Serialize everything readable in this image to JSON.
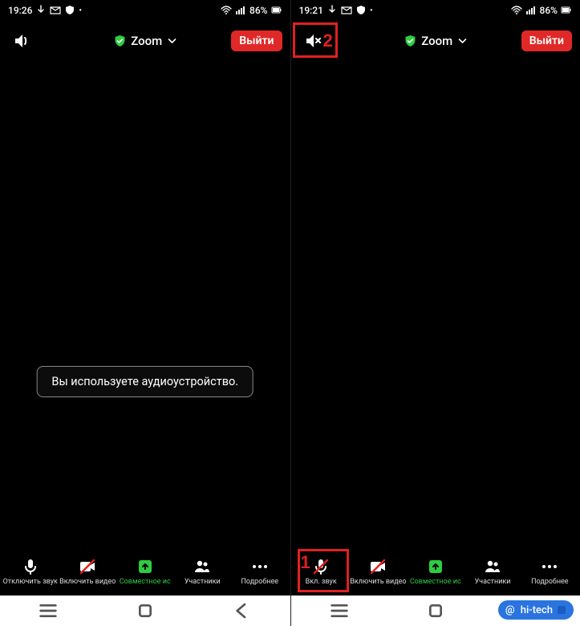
{
  "colors": {
    "accent_red": "#e02828",
    "highlight": "#e02020",
    "green": "#2ecc40"
  },
  "watermark": {
    "text": "hi-tech"
  },
  "screens": [
    {
      "statusbar": {
        "time": "19:26",
        "battery": "86%"
      },
      "topbar": {
        "app_label": "Zoom",
        "leave_label": "Выйти",
        "speaker_state": "on"
      },
      "toast": "Вы используете аудиоустройство.",
      "bottombar": {
        "items": [
          {
            "id": "mute",
            "label": "Отключить звук",
            "variant": "mic"
          },
          {
            "id": "video",
            "label": "Включить видео",
            "variant": "video-off"
          },
          {
            "id": "share",
            "label": "Совместное ис",
            "variant": "share"
          },
          {
            "id": "people",
            "label": "Участники",
            "variant": "people"
          },
          {
            "id": "more",
            "label": "Подробнее",
            "variant": "more"
          }
        ]
      }
    },
    {
      "statusbar": {
        "time": "19:21",
        "battery": "86%"
      },
      "topbar": {
        "app_label": "Zoom",
        "leave_label": "Выйти",
        "speaker_state": "off"
      },
      "bottombar": {
        "items": [
          {
            "id": "unmute",
            "label": "Вкл. звук",
            "variant": "mic-off"
          },
          {
            "id": "video",
            "label": "Включить видео",
            "variant": "video-off"
          },
          {
            "id": "share",
            "label": "Совместное ис",
            "variant": "share"
          },
          {
            "id": "people",
            "label": "Участники",
            "variant": "people"
          },
          {
            "id": "more",
            "label": "Подробнее",
            "variant": "more"
          }
        ]
      },
      "highlights": [
        {
          "num": "2",
          "target": "speaker"
        },
        {
          "num": "1",
          "target": "unmute"
        }
      ]
    }
  ]
}
